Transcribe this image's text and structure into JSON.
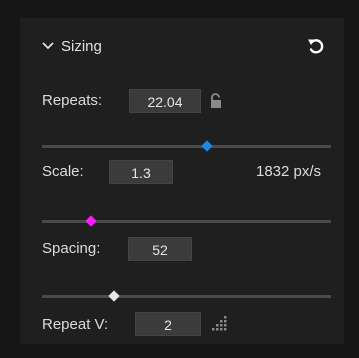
{
  "section": {
    "title": "Sizing",
    "expanded": true,
    "reset_icon": "reset-icon"
  },
  "repeats": {
    "label": "Repeats:",
    "value": "22.04",
    "lock_icon": "unlock-icon",
    "slider_fraction": 0.57,
    "slider_color": "#1e88e5"
  },
  "scale": {
    "label": "Scale:",
    "value": "1.3",
    "readout": "1832 px/s",
    "slider_fraction": 0.17,
    "slider_color": "#ff1aff"
  },
  "spacing": {
    "label": "Spacing:",
    "value": "52",
    "slider_fraction": 0.25,
    "slider_color": "#e6e6e6"
  },
  "repeat_v": {
    "label": "Repeat V:",
    "value": "2",
    "icon": "resize-grip-icon"
  }
}
